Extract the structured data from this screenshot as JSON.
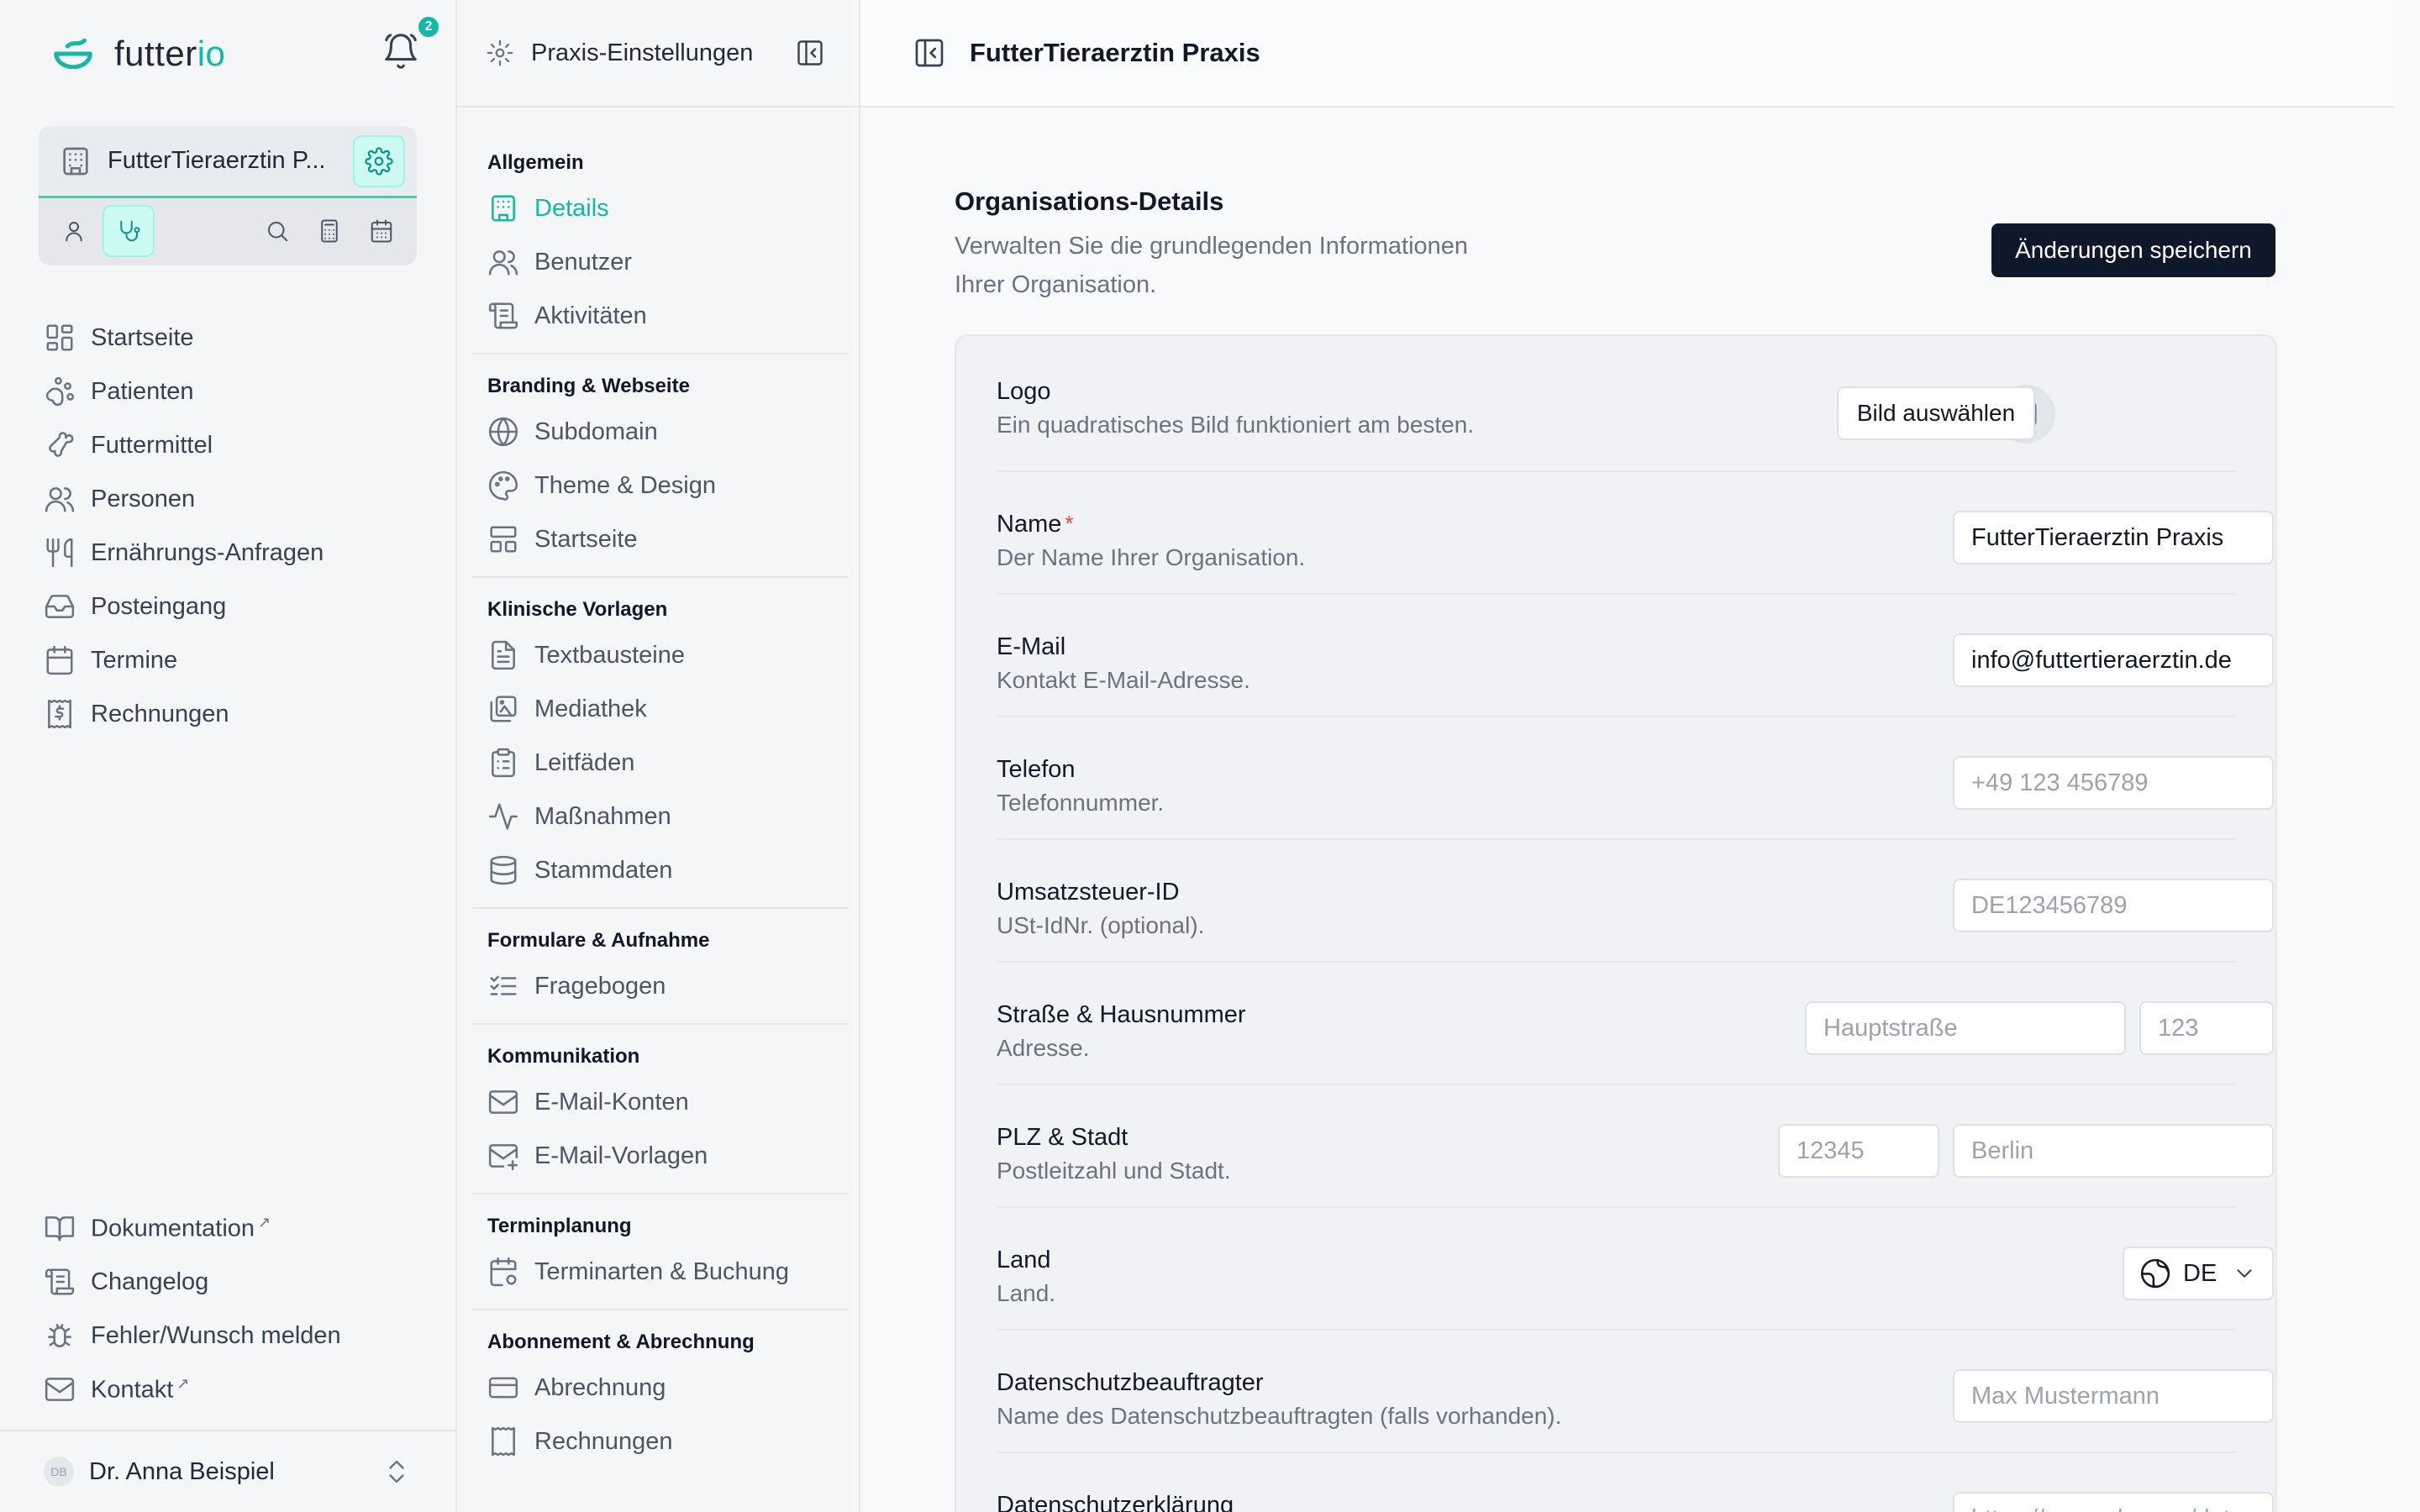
{
  "app": {
    "name_part1": "futter",
    "name_part2": "io",
    "notification_count": "2"
  },
  "org": {
    "name": "FutterTieraerztin P..."
  },
  "nav": {
    "items": [
      {
        "label": "Startseite",
        "icon": "dashboard-icon"
      },
      {
        "label": "Patienten",
        "icon": "paw-icon"
      },
      {
        "label": "Futtermittel",
        "icon": "bone-icon"
      },
      {
        "label": "Personen",
        "icon": "users-icon"
      },
      {
        "label": "Ernährungs-Anfragen",
        "icon": "utensils-icon"
      },
      {
        "label": "Posteingang",
        "icon": "inbox-icon"
      },
      {
        "label": "Termine",
        "icon": "calendar-icon"
      },
      {
        "label": "Rechnungen",
        "icon": "receipt-icon"
      }
    ],
    "bottom": [
      {
        "label": "Dokumentation",
        "ext": "↗"
      },
      {
        "label": "Changelog",
        "ext": ""
      },
      {
        "label": "Fehler/Wunsch melden",
        "ext": ""
      },
      {
        "label": "Kontakt",
        "ext": "↗"
      }
    ]
  },
  "user": {
    "initials": "DB",
    "name": "Dr. Anna Beispiel"
  },
  "settings": {
    "title": "Praxis-Einstellungen",
    "sections": [
      {
        "title": "Allgemein",
        "items": [
          "Details",
          "Benutzer",
          "Aktivitäten"
        ]
      },
      {
        "title": "Branding & Webseite",
        "items": [
          "Subdomain",
          "Theme & Design",
          "Startseite"
        ]
      },
      {
        "title": "Klinische Vorlagen",
        "items": [
          "Textbausteine",
          "Mediathek",
          "Leitfäden",
          "Maßnahmen",
          "Stammdaten"
        ]
      },
      {
        "title": "Formulare & Aufnahme",
        "items": [
          "Fragebogen"
        ]
      },
      {
        "title": "Kommunikation",
        "items": [
          "E-Mail-Konten",
          "E-Mail-Vorlagen"
        ]
      },
      {
        "title": "Terminplanung",
        "items": [
          "Terminarten & Buchung"
        ]
      },
      {
        "title": "Abonnement & Abrechnung",
        "items": [
          "Abrechnung",
          "Rechnungen"
        ]
      }
    ]
  },
  "main": {
    "title": "FutterTieraerztin Praxis",
    "section_title": "Organisations-Details",
    "section_sub_line1": "Verwalten Sie die grundlegenden Informationen",
    "section_sub_line2": "Ihrer Organisation.",
    "save_label": "Änderungen speichern",
    "fields": {
      "logo": {
        "label": "Logo",
        "desc": "Ein quadratisches Bild funktioniert am besten.",
        "button": "Bild auswählen"
      },
      "name": {
        "label": "Name",
        "required": "*",
        "desc": "Der Name Ihrer Organisation.",
        "value": "FutterTieraerztin Praxis"
      },
      "email": {
        "label": "E-Mail",
        "desc": "Kontakt E-Mail-Adresse.",
        "value": "info@futtertieraerztin.de"
      },
      "phone": {
        "label": "Telefon",
        "desc": "Telefonnummer.",
        "placeholder": "+49 123 456789"
      },
      "vat": {
        "label": "Umsatzsteuer-ID",
        "desc": "USt-IdNr. (optional).",
        "placeholder": "DE123456789"
      },
      "street": {
        "label": "Straße & Hausnummer",
        "desc": "Adresse.",
        "placeholder_street": "Hauptstraße",
        "placeholder_no": "123"
      },
      "city": {
        "label": "PLZ & Stadt",
        "desc": "Postleitzahl und Stadt.",
        "placeholder_zip": "12345",
        "placeholder_city": "Berlin"
      },
      "country": {
        "label": "Land",
        "desc": "Land.",
        "value": "DE"
      },
      "dpo": {
        "label": "Datenschutzbeauftragter",
        "desc": "Name des Datenschutzbeauftragten (falls vorhanden).",
        "placeholder": "Max Mustermann"
      },
      "privacy": {
        "label": "Datenschutzerklärung",
        "placeholder": "https://example.com/datenschutz"
      }
    }
  },
  "colors": {
    "accent": "#14b8a6",
    "primary_button": "#0f172a"
  }
}
